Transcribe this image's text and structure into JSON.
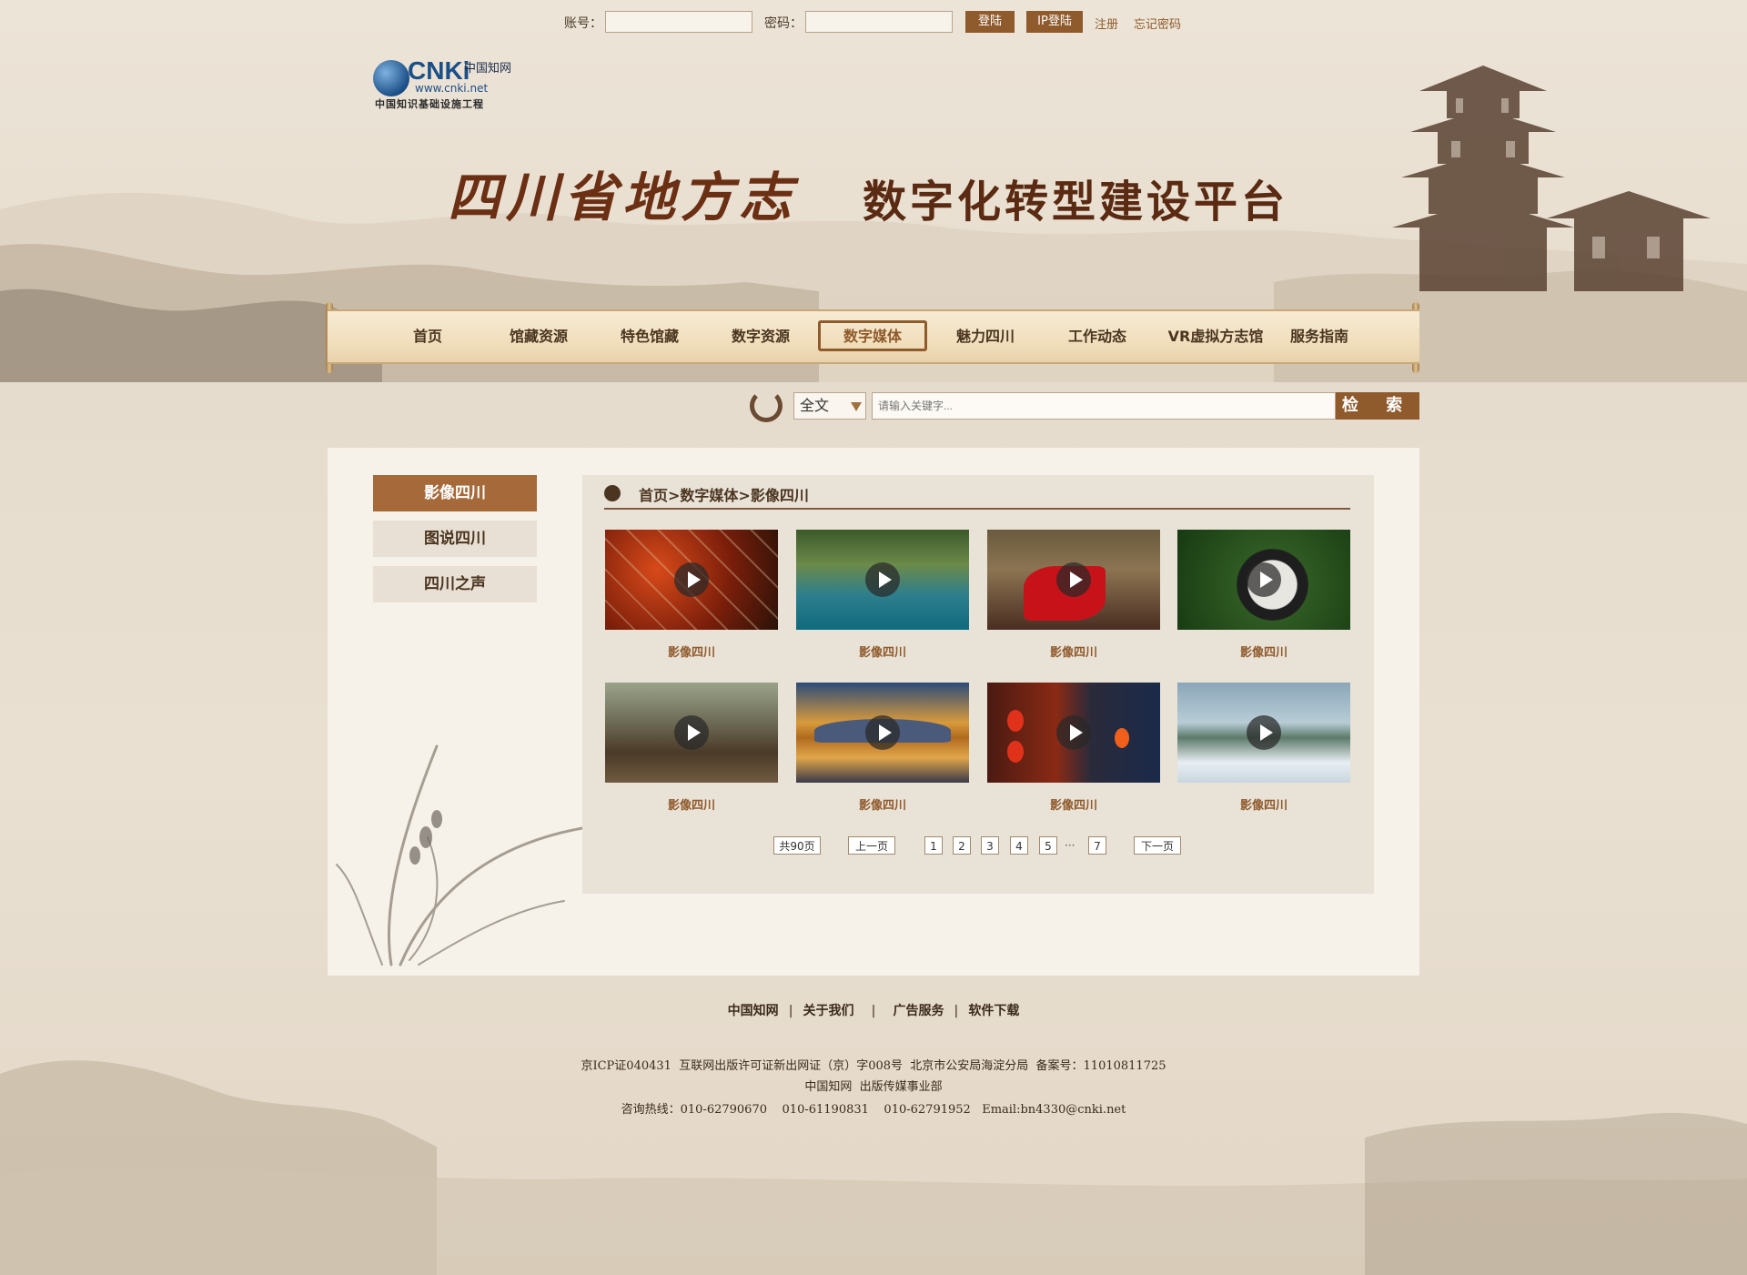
{
  "login": {
    "account_label": "账号：",
    "password_label": "密码：",
    "login_button": "登陆",
    "ip_login_button": "IP登陆",
    "register_link": "注册",
    "forgot_link": "忘记密码"
  },
  "logo": {
    "brand": "CNKi",
    "brand_cn": "中国知网",
    "url": "www.cnki.net",
    "subtitle": "中国知识基础设施工程"
  },
  "banner": {
    "title_main": "四川省地方志",
    "title_sub": "数字化转型建设平台"
  },
  "nav": {
    "items": [
      {
        "label": "首页"
      },
      {
        "label": "馆藏资源"
      },
      {
        "label": "特色馆藏"
      },
      {
        "label": "数字资源"
      },
      {
        "label": "数字媒体"
      },
      {
        "label": "魅力四川"
      },
      {
        "label": "工作动态"
      },
      {
        "label": "VR虚拟方志馆"
      },
      {
        "label": "服务指南"
      }
    ],
    "active_index": 4
  },
  "search": {
    "scope": "全文",
    "placeholder": "请输入关键字...",
    "button": "检 索"
  },
  "sidebar": {
    "items": [
      {
        "label": "影像四川"
      },
      {
        "label": "图说四川"
      },
      {
        "label": "四川之声"
      }
    ],
    "active_index": 0
  },
  "breadcrumb": "首页>数字媒体>影像四川",
  "videos": [
    {
      "caption": "影像四川",
      "scene": "hotpot"
    },
    {
      "caption": "影像四川",
      "scene": "lake"
    },
    {
      "caption": "影像四川",
      "scene": "opera"
    },
    {
      "caption": "影像四川",
      "scene": "panda"
    },
    {
      "caption": "影像四川",
      "scene": "teahouse"
    },
    {
      "caption": "影像四川",
      "scene": "building"
    },
    {
      "caption": "影像四川",
      "scene": "lanterns"
    },
    {
      "caption": "影像四川",
      "scene": "waterfall"
    }
  ],
  "pagination": {
    "total": "共90页",
    "prev": "上一页",
    "pages": [
      "1",
      "2",
      "3",
      "4",
      "5"
    ],
    "ellipsis": "···",
    "last": "7",
    "next": "下一页"
  },
  "footer": {
    "links": [
      "中国知网",
      "关于我们",
      "广告服务",
      "软件下载"
    ],
    "separators": [
      "|",
      "|",
      "|"
    ],
    "icp": "京ICP证040431  互联网出版许可证新出网证（京）字008号  北京市公安局海淀分局  备案号：11010811725",
    "org": "中国知网  出版传媒事业部",
    "contact": "咨询热线：010-62790670    010-61190831    010-62791952   Email:bn4330@cnki.net"
  },
  "colors": {
    "accent": "#8f5a2c",
    "title": "#6b2f14",
    "panel": "#f6f1e9",
    "background": "#e9e0d2"
  }
}
